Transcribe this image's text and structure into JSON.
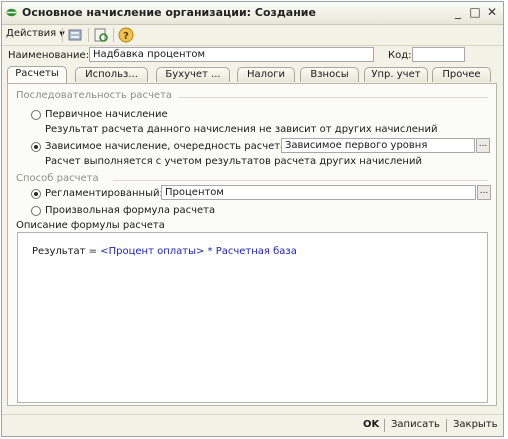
{
  "window": {
    "title": "Основное начисление организации: Создание"
  },
  "toolbar": {
    "actions_label": "Действия"
  },
  "form": {
    "name_label": "Наименование:",
    "name_value": "Надбавка процентом",
    "code_label": "Код:",
    "code_value": ""
  },
  "tabs": [
    "Расчеты",
    "Использ...",
    "Бухучет ...",
    "Налоги",
    "Взносы",
    "Упр. учет",
    "Прочее"
  ],
  "sequence": {
    "section_title": "Последовательность расчета",
    "primary_label": "Первичное начисление",
    "primary_note": "Результат расчета данного начисления не зависит от других начислений",
    "dependent_label": "Зависимое начисление, очередность расчета:",
    "dependent_value": "Зависимое первого уровня",
    "dependent_note": "Расчет выполняется с учетом результатов расчета других начислений"
  },
  "method": {
    "section_title": "Способ расчета",
    "regulated_label": "Регламентированный:",
    "regulated_value": "Процентом",
    "custom_label": "Произвольная формула расчета"
  },
  "formula": {
    "desc_label": "Описание формулы расчета",
    "part1": "Результат = ",
    "part2": "<Процент оплаты>",
    "part3": " * ",
    "part4": "Расчетная база"
  },
  "footer": {
    "ok_label": "OK",
    "save_label": "Записать",
    "close_label": "Закрыть"
  },
  "icons": [
    "minimize-icon",
    "restore-icon",
    "close-icon",
    "help-icon",
    "dropdown-arrow-icon"
  ],
  "colors": {
    "formula_blue": "#2323b4",
    "section_gray": "#8f8e86",
    "window_bg": "#f4f2e6"
  }
}
